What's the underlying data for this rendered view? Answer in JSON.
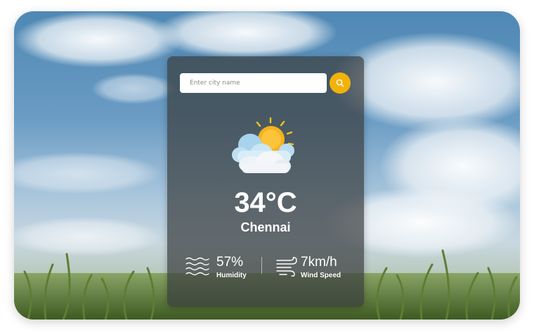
{
  "search": {
    "placeholder": "Enter city name",
    "value": "",
    "button_icon": "search-icon",
    "accent_color": "#f2b20a"
  },
  "weather": {
    "icon": "sun-behind-clouds-icon",
    "temperature": "34°C",
    "city": "Chennai"
  },
  "stats": {
    "humidity": {
      "icon": "humidity-waves-icon",
      "value": "57%",
      "label": "Humidity"
    },
    "wind": {
      "icon": "wind-icon",
      "value": "7km/h",
      "label": "Wind Speed"
    }
  }
}
